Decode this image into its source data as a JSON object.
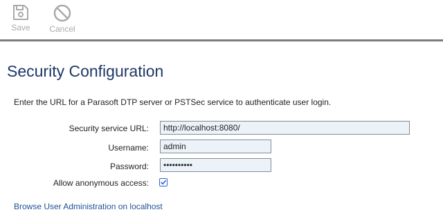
{
  "toolbar": {
    "save_label": "Save",
    "save_icon": "floppy-disk-icon",
    "cancel_label": "Cancel",
    "cancel_icon": "prohibited-icon"
  },
  "page": {
    "title": "Security Configuration",
    "intro": "Enter the URL for a Parasoft DTP server or PSTSec service to authenticate user login."
  },
  "form": {
    "url_label": "Security service URL:",
    "url_value": "http://localhost:8080/",
    "username_label": "Username:",
    "username_value": "admin",
    "password_label": "Password:",
    "password_value": "••••••••••",
    "anonymous_label": "Allow anonymous access:",
    "anonymous_checked": true
  },
  "links": {
    "browse_admin": "Browse User Administration on localhost"
  },
  "colors": {
    "title": "#1d3768",
    "link": "#1f4f96",
    "input_bg": "#edf2f9",
    "disabled": "#a9a9a9",
    "divider": "#7c7c7c",
    "checkbox": "#2e63d6"
  }
}
